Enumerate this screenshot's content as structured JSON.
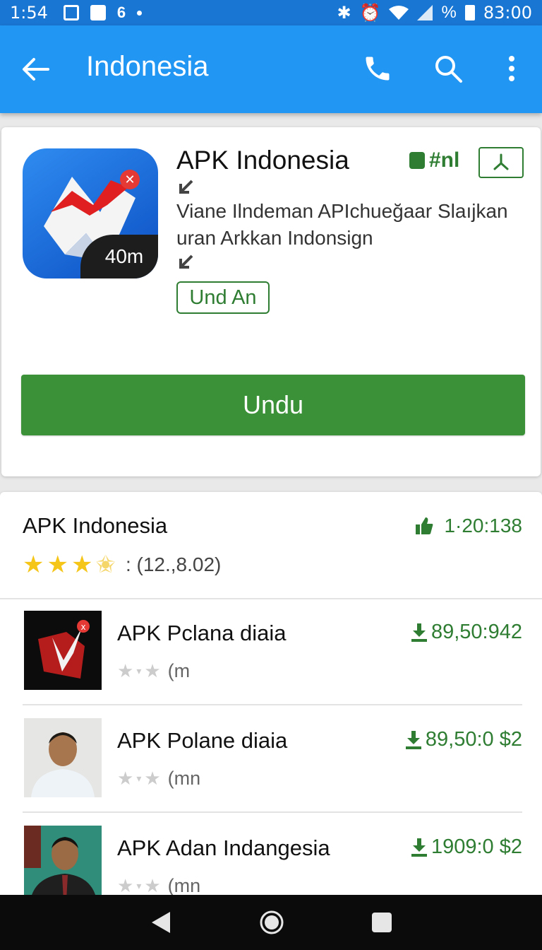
{
  "status_bar": {
    "time": "1:54",
    "battery_pct_symbol": "%",
    "clock_right": "83:00",
    "icons": [
      "photo-icon",
      "media-icon",
      "app-icon",
      "bluetooth-icon",
      "alarm-icon",
      "wifi-icon",
      "signal-icon",
      "battery-icon"
    ]
  },
  "app_bar": {
    "title": "Indonesia",
    "icons": [
      "back-arrow-icon",
      "phone-icon",
      "search-icon",
      "overflow-menu-icon"
    ]
  },
  "app_card": {
    "name": "APK Indonesia",
    "tag": "#nl",
    "description": "Viane Ilndeman APIchueğaar Slaıjkan uran Arkkan Indonsign",
    "icon_badge": "40m",
    "outline_button": "Und An",
    "primary_button": "Undu",
    "colors": {
      "accent_green": "#3b9137",
      "appbar_blue": "#2196f3"
    }
  },
  "list_header": {
    "title": "APK Indonesia",
    "stat": "1·20:138",
    "rating_stars": 3.5,
    "rating_count": ": (12.,8.02)"
  },
  "list_items": [
    {
      "name": "APK Pclana diaia",
      "stat": "89,50:942",
      "unit": "(m",
      "stars": 1
    },
    {
      "name": "APK Polane diaia",
      "stat": "89,50:0 $2",
      "unit": "(mn",
      "stars": 1
    },
    {
      "name": "APK Adan Indangesia",
      "stat": "1909:0 $2",
      "unit": "(mn",
      "stars": 1
    }
  ]
}
